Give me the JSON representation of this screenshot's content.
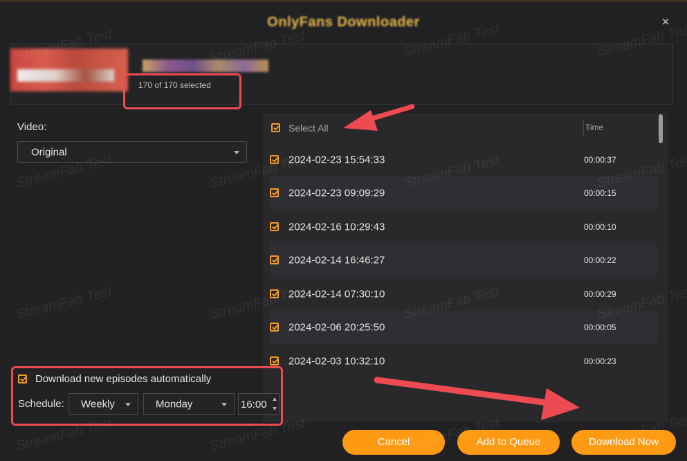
{
  "window": {
    "title": "OnlyFans Downloader",
    "close_icon": "×"
  },
  "header": {
    "selected_text": "170 of 170 selected"
  },
  "video": {
    "label": "Video:",
    "selected": "Original"
  },
  "list": {
    "select_all_label": "Select All",
    "time_header": "Time",
    "rows": [
      {
        "date": "2024-02-23 15:54:33",
        "time": "00:00:37"
      },
      {
        "date": "2024-02-23 09:09:29",
        "time": "00:00:15"
      },
      {
        "date": "2024-02-16 10:29:43",
        "time": "00:00:10"
      },
      {
        "date": "2024-02-14 16:46:27",
        "time": "00:00:22"
      },
      {
        "date": "2024-02-14 07:30:10",
        "time": "00:00:29"
      },
      {
        "date": "2024-02-06 20:25:50",
        "time": "00:00:05"
      },
      {
        "date": "2024-02-03 10:32:10",
        "time": "00:00:23"
      }
    ]
  },
  "schedule": {
    "auto_label": "Download new episodes automatically",
    "label": "Schedule:",
    "frequency": "Weekly",
    "day": "Monday",
    "time": "16:00"
  },
  "buttons": {
    "cancel": "Cancel",
    "add_to_queue": "Add to Queue",
    "download_now": "Download Now"
  },
  "watermark": "StreamFab Test",
  "colors": {
    "accent": "#ff9a12",
    "highlight": "#ee4a52",
    "background": "#212124"
  }
}
